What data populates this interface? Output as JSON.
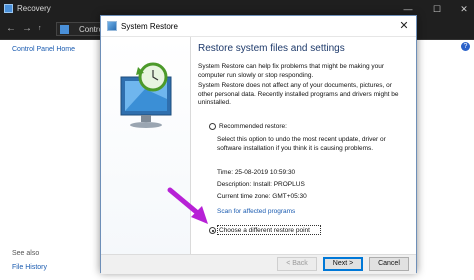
{
  "background_window": {
    "title": "Recovery",
    "address": "Contro",
    "control_panel_home": "Control Panel Home",
    "see_also": "See also",
    "file_history": "File History"
  },
  "dialog": {
    "title": "System Restore",
    "heading": "Restore system files and settings",
    "para1": "System Restore can help fix problems that might be making your computer run slowly or stop responding.",
    "para2": "System Restore does not affect any of your documents, pictures, or other personal data. Recently installed programs and drivers might be uninstalled.",
    "recommended_label": "Recommended restore:",
    "recommended_desc": "Select this option to undo the most recent update, driver or software installation if you think it is causing problems.",
    "time": "Time: 25-08-2019 10:59:30",
    "description": "Description: Install: PROPLUS",
    "timezone": "Current time zone: GMT+05:30",
    "scan_link": "Scan for affected programs",
    "different_label": "Choose a different restore point",
    "selected_option": "different",
    "buttons": {
      "back": "< Back",
      "next": "Next >",
      "cancel": "Cancel"
    }
  },
  "colors": {
    "annotation_arrow": "#b721d6",
    "link": "#1a5bb0",
    "heading": "#1e3a6b"
  }
}
